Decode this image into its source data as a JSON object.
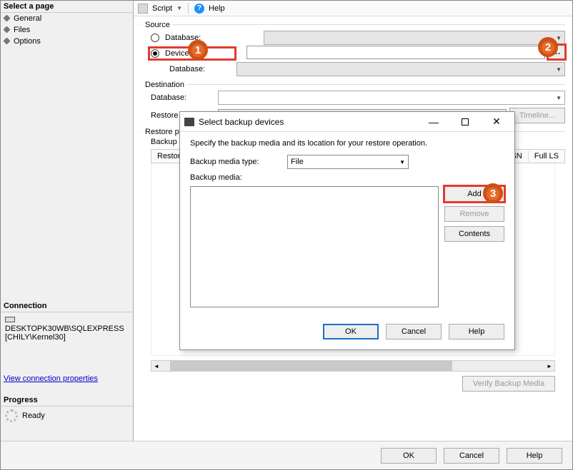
{
  "sidebar": {
    "select_page_title": "Select a page",
    "items": [
      "General",
      "Files",
      "Options"
    ],
    "connection_title": "Connection",
    "connection_value": "DESKTOPK30WB\\SQLEXPRESS [CHILY\\Kernel30]",
    "view_props_link": "View connection properties",
    "progress_title": "Progress",
    "progress_status": "Ready"
  },
  "toolbar": {
    "script_label": "Script",
    "help_label": "Help"
  },
  "source": {
    "group_label": "Source",
    "database_radio_label": "Database:",
    "device_radio_label": "Device:",
    "nested_database_label": "Database:"
  },
  "destination": {
    "group_label": "Destination",
    "database_label": "Database:",
    "restore_to_label": "Restore to:",
    "timeline_btn": "Timeline..."
  },
  "restoreplan": {
    "group_label": "Restore plan",
    "backup_sets_label": "Backup sets:",
    "cols": {
      "restore": "Restore",
      "itlsn": "t LSN",
      "fulllsn": "Full LS"
    },
    "verify_btn": "Verify Backup Media"
  },
  "dialog": {
    "title": "Select backup devices",
    "instruction": "Specify the backup media and its location for your restore operation.",
    "media_type_label": "Backup media type:",
    "media_type_value": "File",
    "media_label": "Backup media:",
    "add_btn": "Add",
    "remove_btn": "Remove",
    "contents_btn": "Contents",
    "ok_btn": "OK",
    "cancel_btn": "Cancel",
    "help_btn": "Help"
  },
  "footer": {
    "ok": "OK",
    "cancel": "Cancel",
    "help": "Help"
  },
  "annotations": {
    "a1": "1",
    "a2": "2",
    "a3": "3"
  },
  "browse_dots": "..."
}
